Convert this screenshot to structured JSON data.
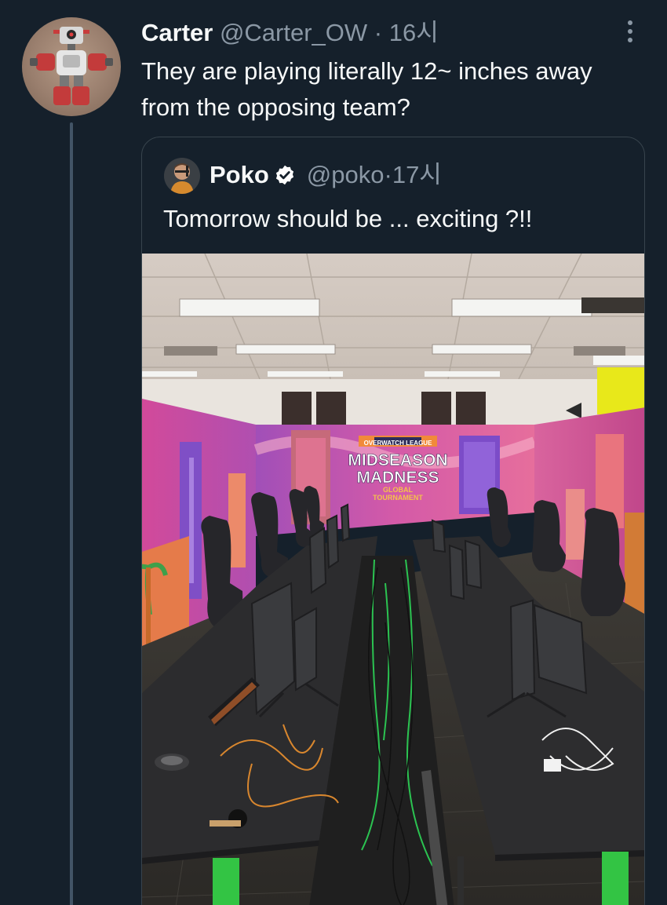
{
  "tweet": {
    "author_name": "Carter",
    "author_handle": "@Carter_OW",
    "separator": "·",
    "time": "16시",
    "text": "They are playing literally 12~ inches away from the opposing team?",
    "avatar_icon": "robot-avatar-icon",
    "more_icon": "more-options-icon"
  },
  "quoted_tweet": {
    "author_name": "Poko",
    "author_handle": "@poko",
    "separator": "·",
    "time": "17시",
    "text": "Tomorrow should be ... exciting ?!!",
    "verified_icon": "verified-badge-icon",
    "photo": {
      "description_icon": "esports-arena-photo",
      "banner_brand": "OVERWATCH LEAGUE",
      "banner_title_1": "MIDSEASON",
      "banner_title_2": "MADNESS",
      "banner_sub_1": "GLOBAL",
      "banner_sub_2": "TOURNAMENT"
    }
  },
  "colors": {
    "background": "#15202b",
    "text_primary": "#f7f9f9",
    "text_secondary": "#8b98a5",
    "border": "#38444d",
    "thread_line": "#425466",
    "verified": "#ffffff"
  }
}
